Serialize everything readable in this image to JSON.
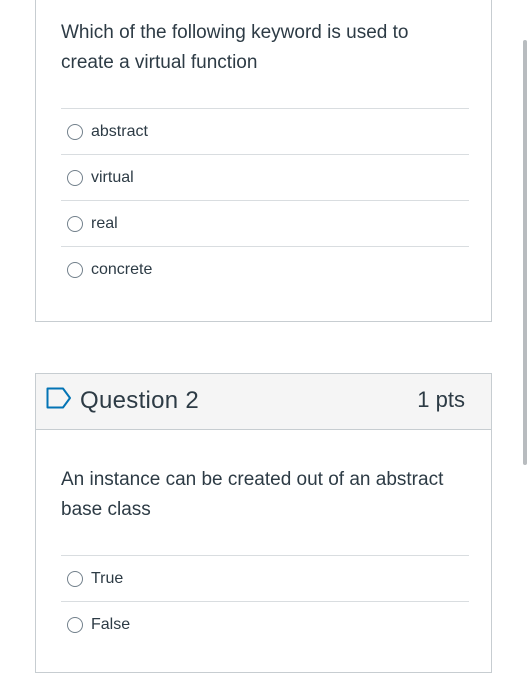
{
  "question1": {
    "text": "Which of the following keyword is used to create a virtual function",
    "answers": [
      "abstract",
      "virtual",
      "real",
      "concrete"
    ]
  },
  "question2": {
    "title": "Question 2",
    "points": "1 pts",
    "text": "An instance can be created out of an abstract base class",
    "answers": [
      "True",
      "False"
    ]
  },
  "colors": {
    "text": "#2d3b45",
    "border": "#c7cdd1",
    "header_bg": "#f5f5f5",
    "flag": "#0374b5"
  },
  "icons": {
    "flag": "bookmark-flag-icon",
    "radio": "radio-unchecked-icon"
  }
}
